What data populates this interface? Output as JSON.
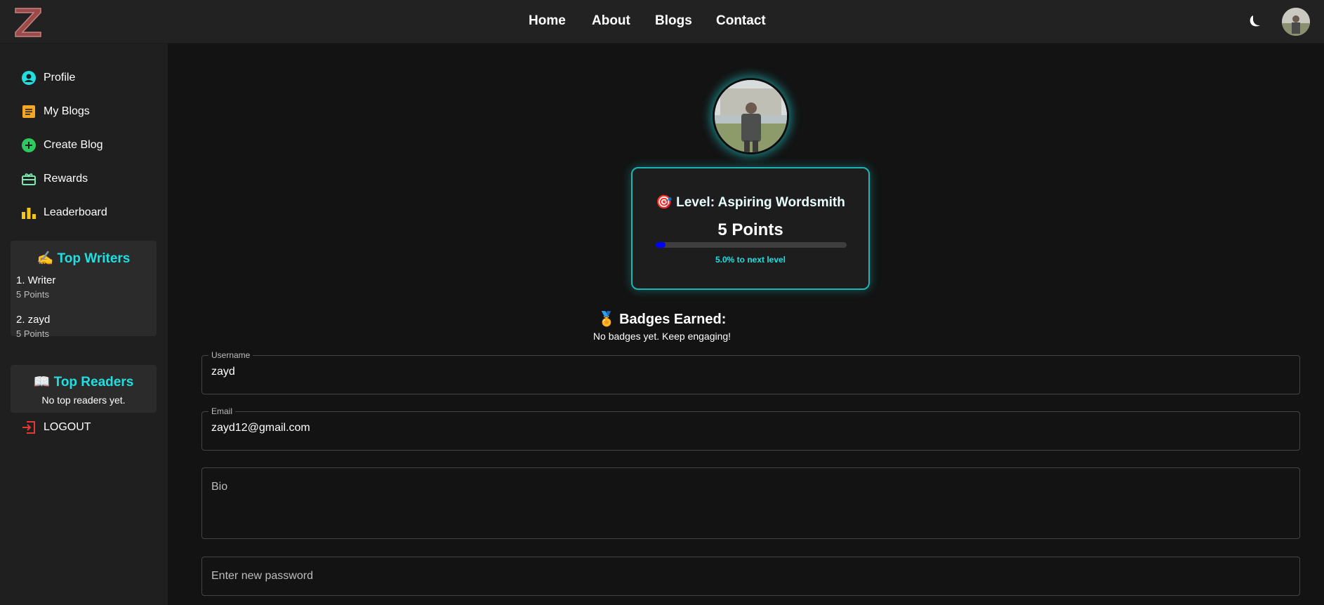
{
  "app": {
    "logo_letter": "Z"
  },
  "nav": {
    "home": "Home",
    "about": "About",
    "blogs": "Blogs",
    "contact": "Contact"
  },
  "sidebar": {
    "items": [
      {
        "label": "Profile",
        "icon": "account-circle-icon"
      },
      {
        "label": "My Blogs",
        "icon": "article-icon"
      },
      {
        "label": "Create Blog",
        "icon": "add-circle-icon"
      },
      {
        "label": "Rewards",
        "icon": "redeem-icon"
      },
      {
        "label": "Leaderboard",
        "icon": "leaderboard-icon"
      }
    ],
    "top_writers": {
      "title": "✍️ Top Writers",
      "entries": [
        {
          "name": "1. Writer",
          "points": "5 Points"
        },
        {
          "name": "2. zayd",
          "points": "5 Points"
        }
      ]
    },
    "top_readers": {
      "title": "📖 Top Readers",
      "empty": "No top readers yet."
    },
    "logout": "LOGOUT"
  },
  "profile": {
    "level": "🎯 Level: Aspiring Wordsmith",
    "points": "5 Points",
    "progress_fraction": 0.05,
    "progress_text": "5.0% to next level",
    "badges_title": "🏅 Badges Earned:",
    "badges_text": "No badges yet. Keep engaging!"
  },
  "form": {
    "username_label": "Username",
    "username_value": "zayd",
    "email_label": "Email",
    "email_value": "zayd12@gmail.com",
    "bio_placeholder": "Bio",
    "password_placeholder": "Enter new password"
  },
  "colors": {
    "accent": "#21dfe0",
    "profile_icon": "#21dfe0",
    "blogs_icon": "#f5a623",
    "create_icon": "#2ec95f",
    "rewards_icon": "#7ee8b3",
    "leaderboard_icon": "#f5c518",
    "logout_icon": "#e53935",
    "progress": "#0000ff"
  }
}
